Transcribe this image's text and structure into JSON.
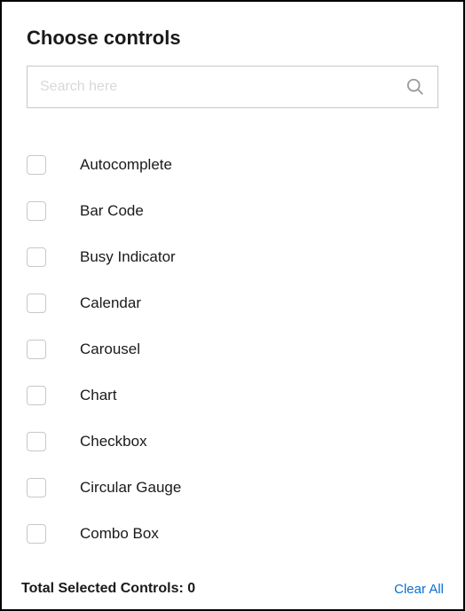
{
  "header": {
    "title": "Choose controls"
  },
  "search": {
    "placeholder": "Search here",
    "value": ""
  },
  "items": [
    {
      "label": "Autocomplete",
      "checked": false
    },
    {
      "label": "Bar Code",
      "checked": false
    },
    {
      "label": "Busy Indicator",
      "checked": false
    },
    {
      "label": "Calendar",
      "checked": false
    },
    {
      "label": "Carousel",
      "checked": false
    },
    {
      "label": "Chart",
      "checked": false
    },
    {
      "label": "Checkbox",
      "checked": false
    },
    {
      "label": "Circular Gauge",
      "checked": false
    },
    {
      "label": "Combo Box",
      "checked": false
    }
  ],
  "footer": {
    "total_label": "Total Selected Controls:",
    "total_count": "0",
    "clear_label": "Clear All"
  }
}
